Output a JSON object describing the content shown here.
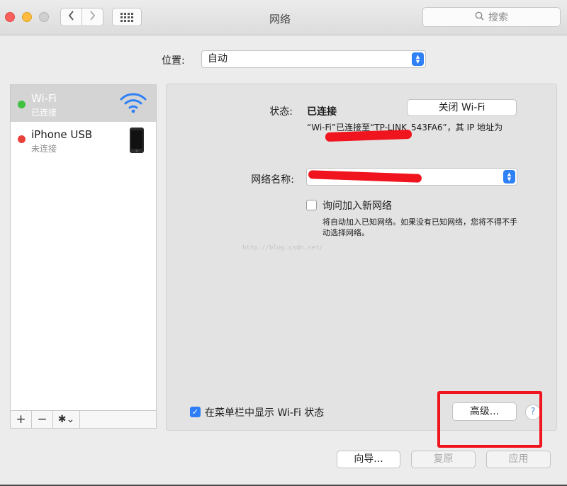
{
  "window": {
    "title": "网络",
    "search_placeholder": "搜索"
  },
  "location": {
    "label": "位置:",
    "value": "自动"
  },
  "sidebar": {
    "services": [
      {
        "name": "Wi-Fi",
        "status": "已连接",
        "status_color": "#3ec23f",
        "icon": "wifi-icon",
        "selected": true
      },
      {
        "name": "iPhone USB",
        "status": "未连接",
        "status_color": "#e8413c",
        "icon": "iphone-icon",
        "selected": false
      }
    ],
    "add_label": "+",
    "remove_label": "−",
    "action_label": "✱⌄"
  },
  "detail": {
    "status_label": "状态:",
    "status_value": "已连接",
    "turn_off_button": "关闭 Wi-Fi",
    "status_description": "“Wi-Fi”已连接至“TP-LINK_543FA6”，其 IP 地址为",
    "network_name_label": "网络名称:",
    "ask_join_label": "询问加入新网络",
    "ask_join_checked": false,
    "ask_join_description": "将自动加入已知网络。如果没有已知网络，您将不得不手动选择网络。",
    "watermark": "http://blog.csdn.net/",
    "show_in_menubar_label": "在菜单栏中显示 Wi-Fi 状态",
    "show_in_menubar_checked": true,
    "advanced_button": "高级...",
    "help_button": "?"
  },
  "footer": {
    "assist_button": "向导...",
    "revert_button": "复原",
    "apply_button": "应用"
  },
  "colors": {
    "accent": "#2f80f5",
    "annotation_red": "#f0141e"
  }
}
